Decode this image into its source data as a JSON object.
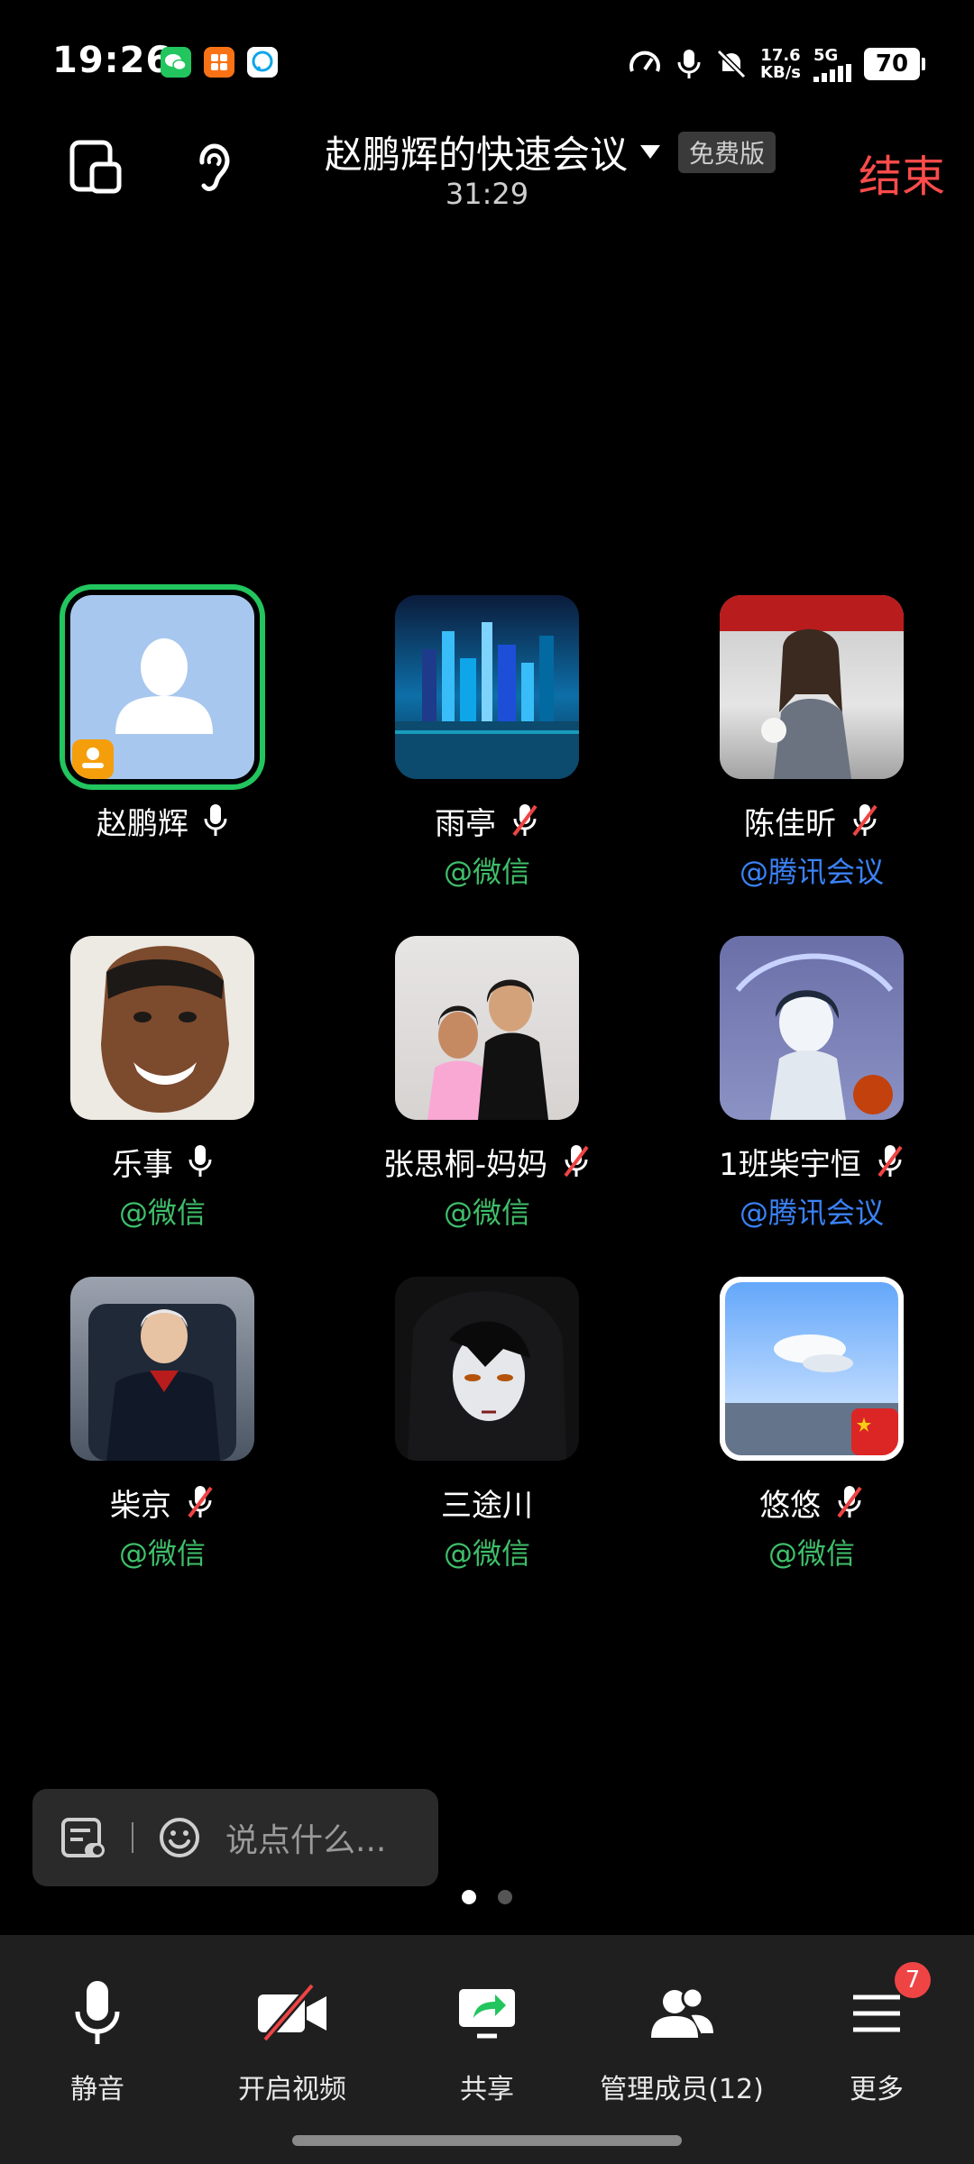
{
  "status_bar": {
    "time": "19:26",
    "network_speed": "17.6",
    "network_unit": "KB/s",
    "network_type": "5G",
    "battery": "70",
    "icons": [
      "wechat-icon",
      "app-icon",
      "message-icon",
      "speedometer-icon",
      "mic-icon",
      "bell-off-icon",
      "signal-icon"
    ]
  },
  "header": {
    "title": "赵鹏辉的快速会议",
    "plan_badge": "免费版",
    "timer": "31:29",
    "end_label": "结束",
    "icons": [
      "pip-window-icon",
      "earpiece-icon",
      "caret-down-icon"
    ],
    "colors": {
      "end": "#ff4b4b"
    }
  },
  "participants": [
    {
      "name": "赵鹏辉",
      "source": "",
      "mic": "on",
      "host": true,
      "avatar": "default-user"
    },
    {
      "name": "雨亭",
      "source": "@微信",
      "mic": "off",
      "host": false,
      "avatar": "city-night"
    },
    {
      "name": "陈佳昕",
      "source": "@腾讯会议",
      "mic": "off",
      "host": false,
      "avatar": "girl-photo"
    },
    {
      "name": "乐事",
      "source": "@微信",
      "mic": "on",
      "host": false,
      "avatar": "face-photo"
    },
    {
      "name": "张思桐-妈妈",
      "source": "@微信",
      "mic": "off",
      "host": false,
      "avatar": "family-photo"
    },
    {
      "name": "1班柴宇恒",
      "source": "@腾讯会议",
      "mic": "off",
      "host": false,
      "avatar": "anime-boy"
    },
    {
      "name": "柴京",
      "source": "@微信",
      "mic": "off",
      "host": false,
      "avatar": "man-photo"
    },
    {
      "name": "三途川",
      "source": "@微信",
      "mic": "off",
      "host": false,
      "avatar": "dark-anime"
    },
    {
      "name": "悠悠",
      "source": "@微信",
      "mic": "off",
      "host": false,
      "avatar": "sky-flag"
    }
  ],
  "chat": {
    "placeholder": "说点什么...",
    "icons": [
      "chat-panel-icon",
      "emoji-icon"
    ]
  },
  "pager": {
    "pages": 2,
    "current": 1
  },
  "toolbar": {
    "mute_label": "静音",
    "video_label": "开启视频",
    "share_label": "共享",
    "members_label": "管理成员(12)",
    "more_label": "更多",
    "more_badge": "7"
  },
  "colors": {
    "wechat_source": "#3fbf6a",
    "tencent_source": "#3b82f6",
    "host_ring": "#22c55e",
    "badge": "#ef4444"
  }
}
